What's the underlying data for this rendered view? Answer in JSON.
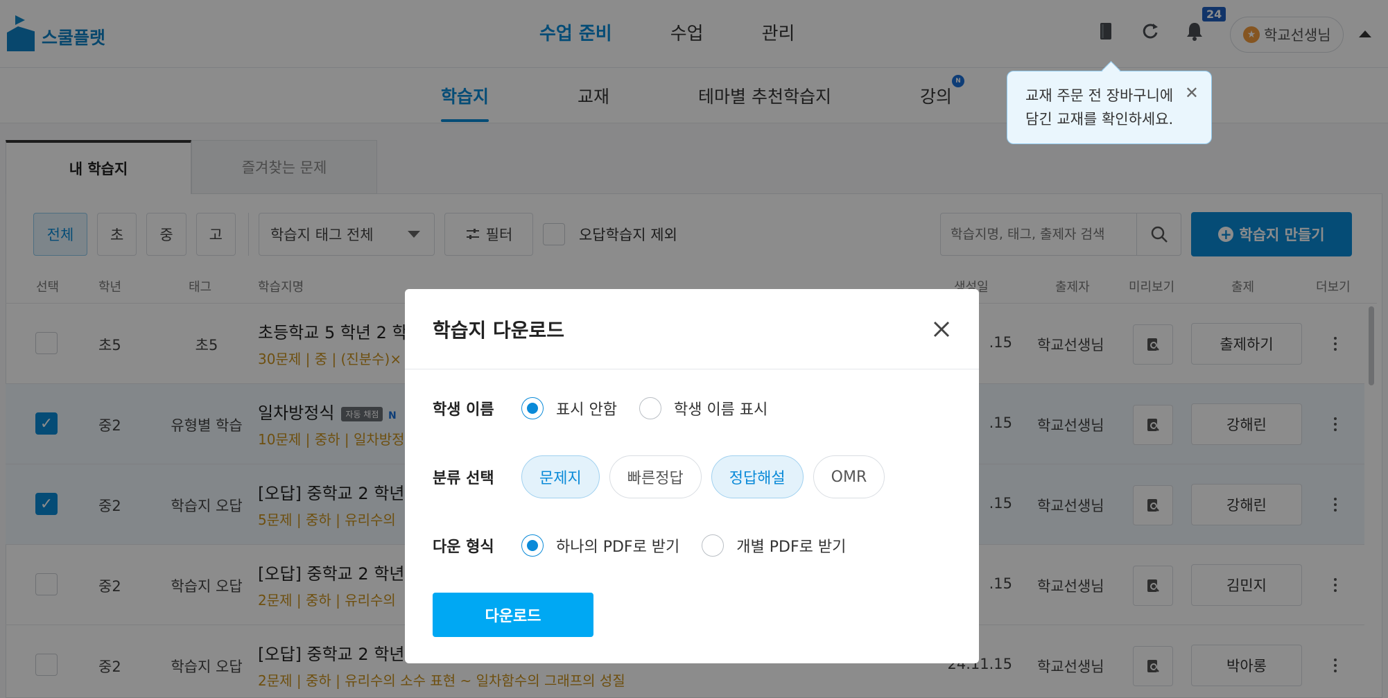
{
  "app": {
    "logo_text": "스쿨플랫"
  },
  "main_nav": [
    "수업 준비",
    "수업",
    "관리"
  ],
  "notifications": {
    "count": "24"
  },
  "user": {
    "name": "학교선생님",
    "star": "★"
  },
  "sub_nav": {
    "items": [
      "학습지",
      "교재",
      "테마별 추천학습지",
      "강의"
    ],
    "new_badge": "N"
  },
  "tooltip": {
    "line1": "교재 주문 전 장바구니에",
    "line2": "담긴 교재를 확인하세요.",
    "close": "✕"
  },
  "content_tabs": [
    "내 학습지",
    "즐겨찾는 문제"
  ],
  "filters": {
    "levels": [
      "전체",
      "초",
      "중",
      "고"
    ],
    "tag_select": "학습지 태그 전체",
    "filter_label": "필터",
    "exclude_wrong": "오답학습지 제외",
    "search_placeholder": "학습지명, 태그, 출제자 검색",
    "create_label": "학습지 만들기"
  },
  "table": {
    "headers": {
      "select": "선택",
      "grade": "학년",
      "tag": "태그",
      "name": "학습지명",
      "date": "생성일",
      "author": "출제자",
      "preview": "미리보기",
      "assign": "출제",
      "more": "더보기"
    },
    "rows": [
      {
        "grade": "초5",
        "tag": "초5",
        "title": "초등학교 5 학년 2 학",
        "meta": "30문제 | 중 | (진분수)×",
        "date": ".15",
        "author": "학교선생님",
        "assign": "출제하기"
      },
      {
        "grade": "중2",
        "tag": "유형별 학습",
        "title": "일차방정식",
        "auto_badge": "자동 채점",
        "badge_letter": "N",
        "meta": "10문제 | 중하 | 일차방정",
        "date": ".15",
        "author": "학교선생님",
        "assign": "강해린"
      },
      {
        "grade": "중2",
        "tag": "학습지 오답",
        "title": "[오답] 중학교 2 학년",
        "meta": "5문제 | 중하 | 유리수의",
        "date": ".15",
        "author": "학교선생님",
        "assign": "강해린"
      },
      {
        "grade": "중2",
        "tag": "학습지 오답",
        "title": "[오답] 중학교 2 학년",
        "meta": "2문제 | 중하 | 유리수의",
        "date": ".15",
        "author": "학교선생님",
        "assign": "김민지"
      },
      {
        "grade": "중2",
        "tag": "학습지 오답",
        "title": "[오답] 중학교 2 학년",
        "meta": "2문제 | 중하 | 유리수의 소수 표현 ~ 일차함수의 그래프의 성질",
        "date": "24.11.15",
        "author": "학교선생님",
        "assign": "박아롱"
      }
    ]
  },
  "modal": {
    "title": "학습지 다운로드",
    "student_name": {
      "label": "학생 이름",
      "options": [
        "표시 안함",
        "학생 이름 표시"
      ],
      "selected": "표시 안함"
    },
    "category": {
      "label": "분류 선택",
      "options": [
        "문제지",
        "빠른정답",
        "정답해설",
        "OMR"
      ],
      "selected": [
        "문제지",
        "정답해설"
      ]
    },
    "format": {
      "label": "다운 형식",
      "options": [
        "하나의 PDF로 받기",
        "개별 PDF로 받기"
      ],
      "selected": "하나의 PDF로 받기"
    },
    "download_label": "다운로드"
  },
  "colors": {
    "accent": "#0a8ad8",
    "download": "#00a8f3",
    "meta": "#c8911d",
    "selected_row": "#eef6fb"
  }
}
